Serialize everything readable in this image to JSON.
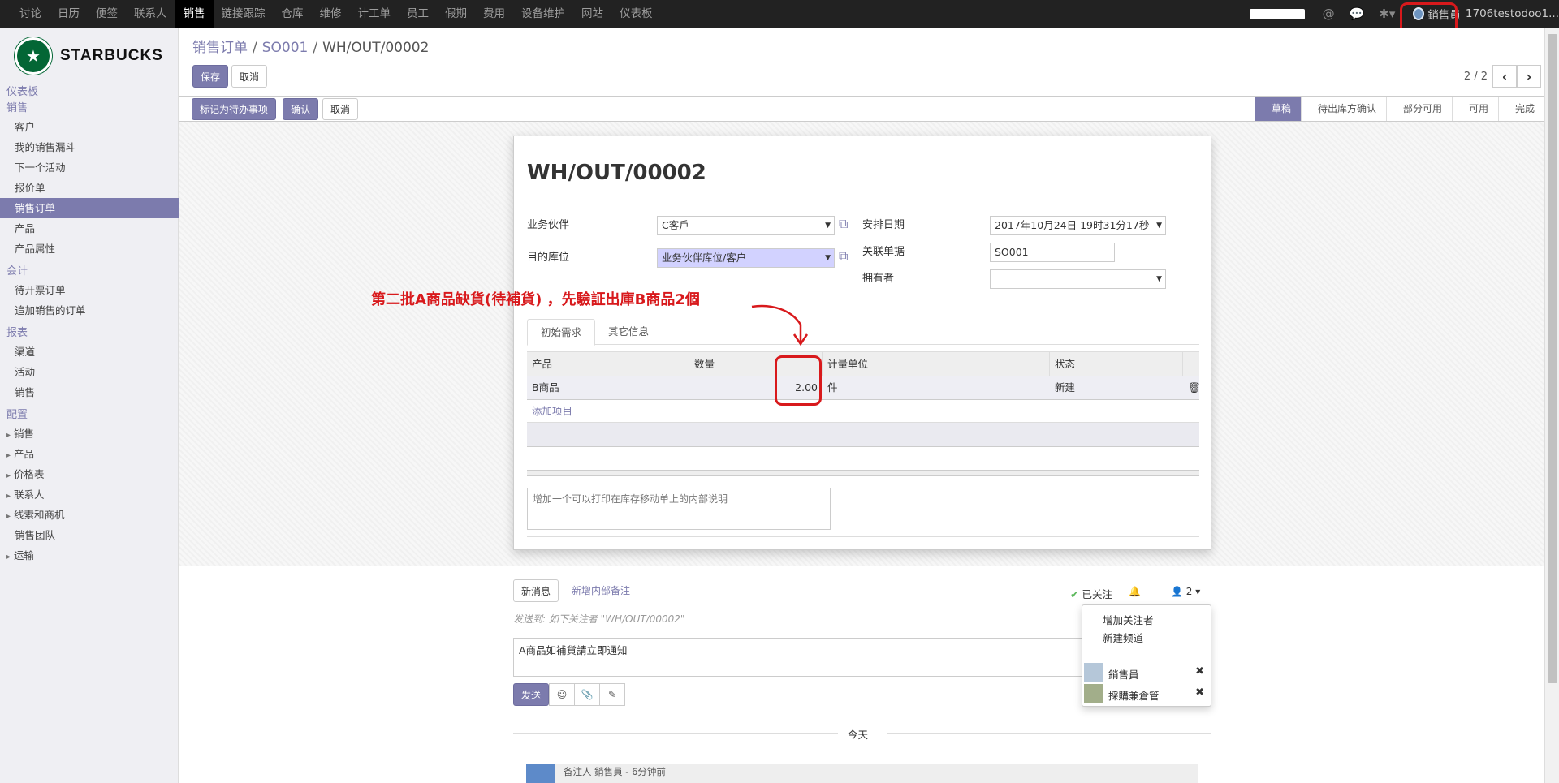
{
  "topmenu": [
    "讨论",
    "日历",
    "便签",
    "联系人",
    "销售",
    "链接跟踪",
    "仓库",
    "维修",
    "计工单",
    "员工",
    "假期",
    "费用",
    "设备维护",
    "网站",
    "仪表板"
  ],
  "topmenu_active": 4,
  "user": {
    "name": "銷售員",
    "db": "1706testodoo1..."
  },
  "logo": {
    "text": "STARBUCKS"
  },
  "sidebar": {
    "dashboard": "仪表板",
    "sections": [
      {
        "title": "销售",
        "items": [
          {
            "label": "客户"
          },
          {
            "label": "我的销售漏斗"
          },
          {
            "label": "下一个活动"
          },
          {
            "label": "报价单"
          },
          {
            "label": "销售订单",
            "active": true
          },
          {
            "label": "产品"
          },
          {
            "label": "产品属性"
          }
        ]
      },
      {
        "title": "会计",
        "items": [
          {
            "label": "待开票订单"
          },
          {
            "label": "追加销售的订单"
          }
        ]
      },
      {
        "title": "报表",
        "items": [
          {
            "label": "渠道"
          },
          {
            "label": "活动"
          },
          {
            "label": "销售"
          }
        ]
      },
      {
        "title": "配置",
        "items": [
          {
            "label": "销售",
            "exp": true
          },
          {
            "label": "产品",
            "exp": true
          },
          {
            "label": "价格表",
            "exp": true
          },
          {
            "label": "联系人",
            "exp": true
          },
          {
            "label": "线索和商机",
            "exp": true
          },
          {
            "label": "销售团队"
          },
          {
            "label": "运输",
            "exp": true
          }
        ]
      }
    ]
  },
  "breadcrumb": {
    "root": "销售订单",
    "mid": "SO001",
    "cur": "WH/OUT/00002"
  },
  "buttons": {
    "save": "保存",
    "discard": "取消"
  },
  "pager": {
    "value": "2 / 2"
  },
  "statusbar": {
    "mark_todo": "标记为待办事项",
    "confirm": "确认",
    "cancel": "取消",
    "steps": [
      "草稿",
      "待出库方确认",
      "部分可用",
      "可用",
      "完成"
    ],
    "current_step": 0
  },
  "form": {
    "title": "WH/OUT/00002",
    "partner_label": "业务伙伴",
    "partner": "C客戶",
    "dest_label": "目的库位",
    "dest": "业务伙伴库位/客户",
    "sched_label": "安排日期",
    "sched": "2017年10月24日 19时31分17秒",
    "origin_label": "关联单据",
    "origin": "SO001",
    "owner_label": "拥有者",
    "owner": ""
  },
  "tabs": [
    "初始需求",
    "其它信息"
  ],
  "table": {
    "headers": [
      "产品",
      "数量",
      "计量单位",
      "状态"
    ],
    "row": {
      "product": "B商品",
      "qty": "2.00",
      "uom": "件",
      "state": "新建"
    },
    "add": "添加项目"
  },
  "note_placeholder": "增加一个可以打印在库存移动单上的内部说明",
  "annotation": "第二批A商品缺貨(待補貨) ，先驗証出庫B商品2個",
  "chatter": {
    "new_message": "新消息",
    "log_note": "新增内部备注",
    "following": "已关注",
    "followers": "2",
    "send_to": "发送到: 如下关注者 \"WH/OUT/00002\"",
    "message": "A商品如補貨請立即通知",
    "send": "发送",
    "today": "今天",
    "msg_header": "备注人 銷售員 - 6分钟前"
  },
  "dropdown": {
    "add_followers": "增加关注者",
    "new_channel": "新建频道",
    "followers": [
      "銷售員",
      "採購兼倉管"
    ]
  }
}
